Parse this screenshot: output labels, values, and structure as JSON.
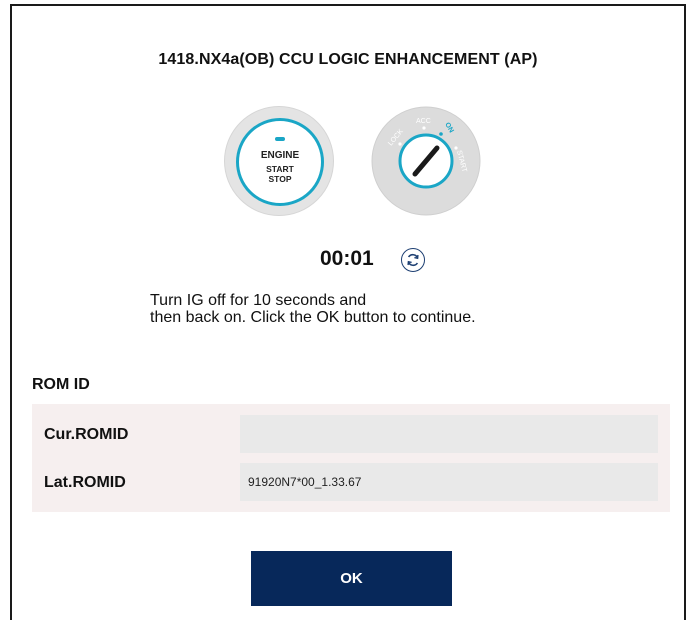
{
  "dialog": {
    "title": "1418.NX4a(OB) CCU LOGIC ENHANCEMENT (AP)"
  },
  "engine_button": {
    "line1": "ENGINE",
    "line2": "START",
    "line3": "STOP",
    "icon": "engine-start-stop-icon",
    "accent_color": "#1aa6c6"
  },
  "ignition_key": {
    "icon": "ignition-key-icon",
    "positions": [
      "LOCK",
      "ACC",
      "ON",
      "START"
    ],
    "active_position": "ON"
  },
  "timer": {
    "value": "00:01",
    "refresh_icon": "refresh-icon"
  },
  "instruction": {
    "line1": "Turn IG off for 10 seconds and",
    "line2": "then back on. Click the OK button to continue."
  },
  "rom": {
    "section_title": "ROM ID",
    "rows": [
      {
        "label": "Cur.ROMID",
        "value": ""
      },
      {
        "label": "Lat.ROMID",
        "value": "91920N7*00_1.33.67"
      }
    ]
  },
  "actions": {
    "ok_label": "OK",
    "ok_color": "#07285a"
  }
}
